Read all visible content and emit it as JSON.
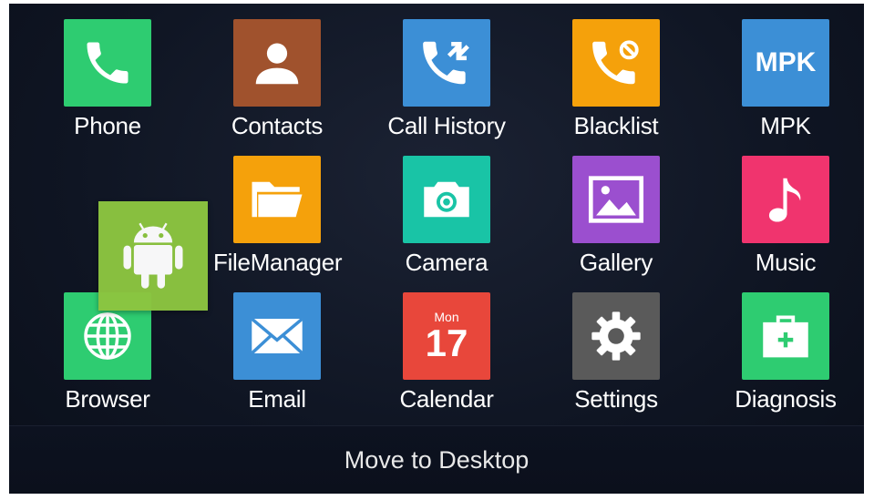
{
  "apps": [
    {
      "label": "Phone",
      "color": "#2ecc71",
      "icon": "phone-icon"
    },
    {
      "label": "Contacts",
      "color": "#a0522d",
      "icon": "person-icon"
    },
    {
      "label": "Call History",
      "color": "#3c8fd6",
      "icon": "call-history-icon"
    },
    {
      "label": "Blacklist",
      "color": "#f5a10b",
      "icon": "blocked-call-icon"
    },
    {
      "label": "MPK",
      "color": "#3c8fd6",
      "icon": "mpk-icon",
      "tile_text": "MPK"
    },
    {
      "label": "FileManager",
      "color": "#f5a10b",
      "icon": "folder-icon"
    },
    {
      "label": "Camera",
      "color": "#19c4a6",
      "icon": "camera-icon"
    },
    {
      "label": "Gallery",
      "color": "#9b4fcf",
      "icon": "image-icon"
    },
    {
      "label": "Music",
      "color": "#f0346e",
      "icon": "music-note-icon"
    },
    {
      "label": "Browser",
      "color": "#2ecc71",
      "icon": "globe-icon"
    },
    {
      "label": "Email",
      "color": "#3c8fd6",
      "icon": "envelope-icon"
    },
    {
      "label": "Calendar",
      "color": "#e8473b",
      "icon": "calendar-icon",
      "month": "Mon",
      "day": "17"
    },
    {
      "label": "Settings",
      "color": "#5a5a5a",
      "icon": "gear-icon"
    },
    {
      "label": "Diagnosis",
      "color": "#2ecc71",
      "icon": "first-aid-kit-icon"
    }
  ],
  "dragged_app": {
    "color": "#8cc540",
    "icon": "android-robot-icon"
  },
  "move_to_desktop": "Move to Desktop"
}
